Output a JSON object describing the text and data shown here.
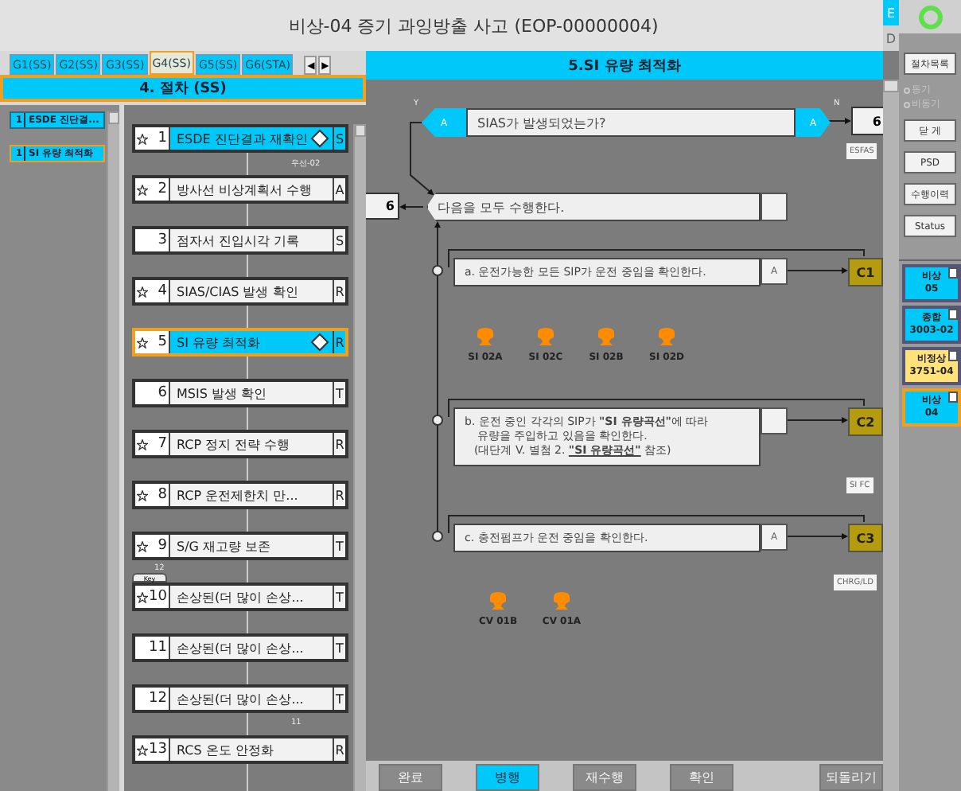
{
  "window": {
    "title": "비상-04 증기 과잉방출 사고 (EOP-00000004)",
    "mode_flags": [
      "E",
      "D"
    ]
  },
  "tabs": [
    {
      "label": "G1(SS)",
      "selected": false
    },
    {
      "label": "G2(SS)",
      "selected": false
    },
    {
      "label": "G3(SS)",
      "selected": false
    },
    {
      "label": "G4(SS)",
      "selected": true
    },
    {
      "label": "G5(SS)",
      "selected": false
    },
    {
      "label": "G6(STA)",
      "selected": false
    }
  ],
  "tab_scroll": [
    "◀",
    "▶"
  ],
  "procedure_header": "4. 절차 (SS)",
  "history": [
    {
      "number": "1",
      "label": "ESDE 진단결...",
      "current": false
    },
    {
      "number": "1",
      "label": "SI 유량 최적화",
      "current": true
    }
  ],
  "steps": [
    {
      "number": "1",
      "text": "ESDE 진단결과 재확인",
      "type": "S",
      "star": true,
      "diamond": true,
      "selected": true,
      "current": false,
      "branch": "우선-02"
    },
    {
      "number": "2",
      "text": "방사선 비상계획서 수행",
      "type": "A",
      "star": true,
      "diamond": false,
      "selected": false,
      "current": false
    },
    {
      "number": "3",
      "text": "점자서 진입시각 기록",
      "type": "S",
      "star": false,
      "diamond": false,
      "selected": false,
      "current": false
    },
    {
      "number": "4",
      "text": "SIAS/CIAS 발생 확인",
      "type": "R",
      "star": true,
      "diamond": false,
      "selected": false,
      "current": false
    },
    {
      "number": "5",
      "text": "SI 유량 최적화",
      "type": "R",
      "star": true,
      "diamond": true,
      "selected": true,
      "current": true
    },
    {
      "number": "6",
      "text": "MSIS 발생 확인",
      "type": "T",
      "star": false,
      "diamond": false,
      "selected": false,
      "current": false
    },
    {
      "number": "7",
      "text": "RCP 정지 전략 수행",
      "type": "R",
      "star": true,
      "diamond": false,
      "selected": false,
      "current": false
    },
    {
      "number": "8",
      "text": "RCP 운전제한치 만...",
      "type": "R",
      "star": true,
      "diamond": false,
      "selected": false,
      "current": false
    },
    {
      "number": "9",
      "text": "S/G 재고량 보존",
      "type": "T",
      "star": true,
      "diamond": false,
      "selected": false,
      "current": false
    },
    {
      "number": "10",
      "text": "손상된(더 많이 손상...",
      "type": "T",
      "star": true,
      "diamond": false,
      "selected": false,
      "current": false,
      "key_tab": "Key",
      "branch_in": "12"
    },
    {
      "number": "11",
      "text": "손상된(더 많이 손상...",
      "type": "T",
      "star": false,
      "diamond": false,
      "selected": false,
      "current": false
    },
    {
      "number": "12",
      "text": "손상된(더 많이 손상...",
      "type": "T",
      "star": false,
      "diamond": false,
      "selected": false,
      "current": false,
      "branch": "11"
    },
    {
      "number": "13",
      "text": "RCS 온도 안정화",
      "type": "R",
      "star": true,
      "diamond": false,
      "selected": false,
      "current": false
    }
  ],
  "detail": {
    "title": "5.SI 유량 최적화",
    "decision": {
      "tag_left": "A",
      "question": "SIAS가 발생되었는가?",
      "tag_right": "A",
      "yes": "Y",
      "no": "N",
      "no_target": "6",
      "no_label": "ESFAS"
    },
    "action": {
      "back_target": "6",
      "text": "다음을 모두 수행한다."
    },
    "substeps": [
      {
        "lines": [
          "a. 운전가능한 모든 SIP가 운전 중임을 확인한다."
        ],
        "mark": "A",
        "code": "C1",
        "valves": [
          "SI 02A",
          "SI 02C",
          "SI 02B",
          "SI 02D"
        ]
      },
      {
        "lines": [
          "b. 운전 중인 각각의 SIP가 **\"SI 유량곡선\"**에 따라",
          "유량을 주입하고 있음을 확인한다."
        ],
        "note_before": "(대단계 V. 별첨 2. ",
        "link": "\"SI 유량곡선\"",
        "note_after": " 참조)",
        "code": "C2",
        "label": "SI FC"
      },
      {
        "lines": [
          "c. 충전펌프가 운전 중임을 확인한다."
        ],
        "mark": "A",
        "code": "C3",
        "label": "CHRG/LD",
        "valves": [
          "CV 01B",
          "CV 01A"
        ]
      }
    ]
  },
  "bottom_buttons": [
    {
      "label": "완료",
      "selected": false
    },
    {
      "label": "병행",
      "selected": true
    },
    {
      "label": "재수행",
      "selected": false
    },
    {
      "label": "확인",
      "selected": false
    },
    {
      "label": "되돌리기",
      "selected": false
    }
  ],
  "side": {
    "buttons_top": [
      "절차목록"
    ],
    "sync": [
      {
        "label": "동기",
        "selected": false
      },
      {
        "label": "비동기",
        "selected": false
      }
    ],
    "sync_disabled": true,
    "buttons": [
      "닫 게",
      "PSD",
      "수행이력",
      "Status"
    ],
    "procedures": [
      {
        "title": "비상",
        "code": "05",
        "color": "#00c8f8",
        "current": false
      },
      {
        "title": "종합",
        "code": "3003-02",
        "color": "#00c8f8",
        "current": false
      },
      {
        "title": "비정상",
        "code": "3751-04",
        "color": "#ffe27a",
        "current": false
      },
      {
        "title": "비상",
        "code": "04",
        "color": "#00c8f8",
        "current": true
      }
    ]
  }
}
